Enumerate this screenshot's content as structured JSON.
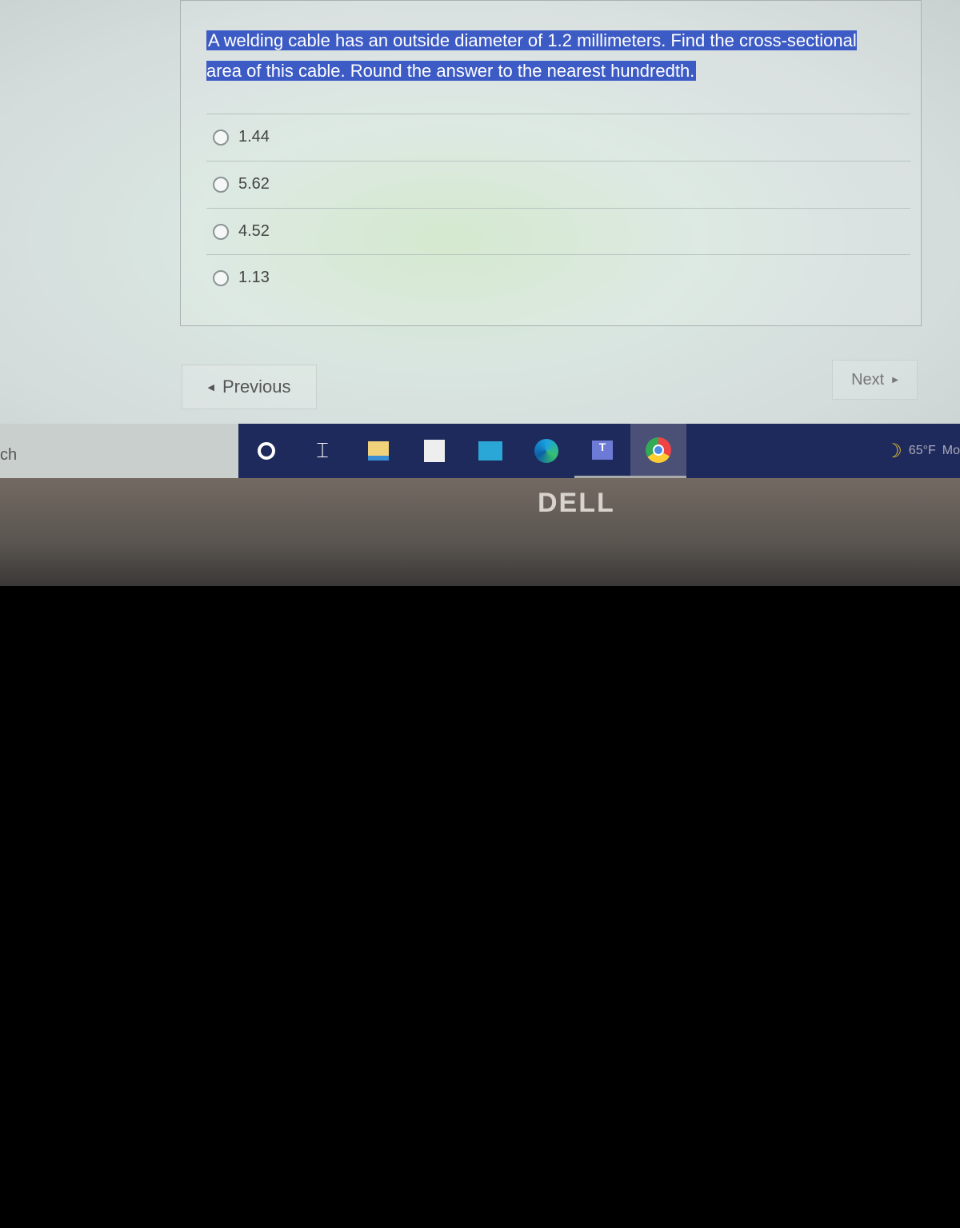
{
  "question": "A welding cable has an outside diameter of 1.2 millimeters. Find the cross-sectional area of this cable. Round the answer to the nearest hundredth.",
  "options": [
    "1.44",
    "5.62",
    "4.52",
    "1.13"
  ],
  "nav": {
    "previous": "Previous",
    "next": "Next"
  },
  "taskbar": {
    "search_fragment": "ch",
    "weather": "65°F",
    "weather_fragment": "Mo",
    "icons": [
      "cortana-icon",
      "task-view-icon",
      "file-explorer-icon",
      "store-icon",
      "mail-icon",
      "edge-icon",
      "teams-icon",
      "chrome-icon"
    ]
  },
  "logo": "DELL"
}
